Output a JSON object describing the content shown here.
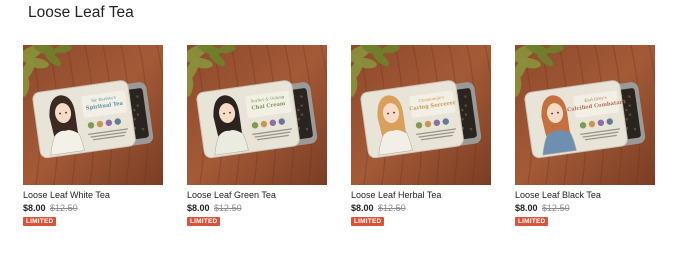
{
  "section": {
    "title": "Loose Leaf Tea"
  },
  "products": [
    {
      "name": "Loose Leaf White Tea",
      "price": "$8.00",
      "compare_price": "$12.50",
      "badge": "LIMITED",
      "tin": {
        "subtitle": "Sir Barista's",
        "title": "Spiritual Tea",
        "label_color": "#5a8fa8",
        "hair": "#3b2a22",
        "outfit": "#f4f1e8"
      }
    },
    {
      "name": "Loose Leaf Green Tea",
      "price": "$8.00",
      "compare_price": "$12.50",
      "badge": "LIMITED",
      "tin": {
        "subtitle": "Sorbet & Oolong",
        "title": "Chai Cream",
        "label_color": "#7c9a5a",
        "hair": "#2b2320",
        "outfit": "#e9ecdf"
      }
    },
    {
      "name": "Loose Leaf Herbal Tea",
      "price": "$8.00",
      "compare_price": "$12.50",
      "badge": "LIMITED",
      "tin": {
        "subtitle": "Chamomile's",
        "title": "Caring Sorcerer",
        "label_color": "#c79a52",
        "hair": "#d9a05b",
        "outfit": "#f3efe6"
      }
    },
    {
      "name": "Loose Leaf Black Tea",
      "price": "$8.00",
      "compare_price": "$12.50",
      "badge": "LIMITED",
      "tin": {
        "subtitle": "Earl Grey's",
        "title": "Calcified Combatant",
        "label_color": "#b0725a",
        "hair": "#c4703f",
        "outfit": "#6f8fb0"
      }
    }
  ]
}
